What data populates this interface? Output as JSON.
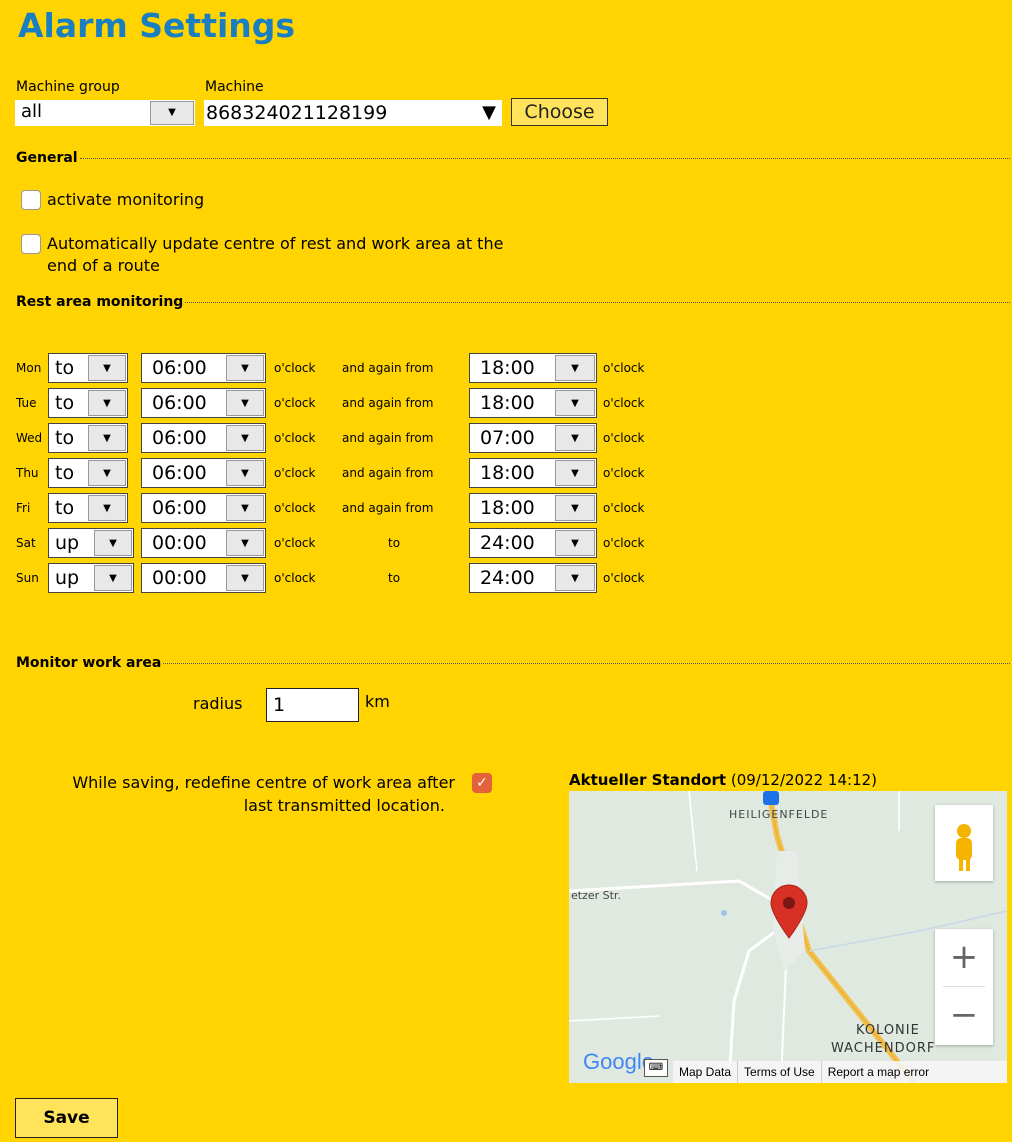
{
  "header": {
    "title": "Alarm Settings"
  },
  "machine": {
    "group_label": "Machine group",
    "group_value": "all",
    "machine_label": "Machine",
    "machine_value": "868324021128199",
    "choose_label": "Choose"
  },
  "general": {
    "title": "General",
    "activate_label": "activate monitoring",
    "activate_checked": false,
    "auto_update_label_1": "Automatically update centre of rest and work area at the",
    "auto_update_label_2": "end of a route",
    "auto_update_checked": false
  },
  "rest": {
    "title": "Rest area monitoring",
    "oclock": "o'clock",
    "days": [
      {
        "day": "Mon",
        "mode": "to",
        "time1": "06:00",
        "middle": "and again from",
        "time2": "18:00"
      },
      {
        "day": "Tue",
        "mode": "to",
        "time1": "06:00",
        "middle": "and again from",
        "time2": "18:00"
      },
      {
        "day": "Wed",
        "mode": "to",
        "time1": "06:00",
        "middle": "and again from",
        "time2": "07:00"
      },
      {
        "day": "Thu",
        "mode": "to",
        "time1": "06:00",
        "middle": "and again from",
        "time2": "18:00"
      },
      {
        "day": "Fri",
        "mode": "to",
        "time1": "06:00",
        "middle": "and again from",
        "time2": "18:00"
      },
      {
        "day": "Sat",
        "mode": "up",
        "time1": "00:00",
        "middle": "to",
        "time2": "24:00"
      },
      {
        "day": "Sun",
        "mode": "up",
        "time1": "00:00",
        "middle": "to",
        "time2": "24:00"
      }
    ]
  },
  "work": {
    "title": "Monitor work area",
    "radius_label": "radius",
    "radius_value": "1",
    "radius_unit": "km",
    "redefine_line1": "While saving, redefine centre of work area after",
    "redefine_line2": "last transmitted location.",
    "redefine_checked": true
  },
  "location": {
    "title": "Aktueller Standort",
    "timestamp": "(09/12/2022 14:12)"
  },
  "map": {
    "place1": "HEILIGENFELDE",
    "place2_1": "KOLONIE",
    "place2_2": "WACHENDORF",
    "street": "etzer Str.",
    "logo": "Google",
    "attrib_data": "Map Data",
    "attrib_terms": "Terms of Use",
    "attrib_report": "Report a map error",
    "colors": {
      "land": "#dfe9df",
      "highway": "#f2c14e",
      "pin": "#d93025"
    }
  },
  "footer": {
    "save_label": "Save"
  },
  "colors": {
    "background": "#ffd400",
    "title": "#1a7fc0",
    "checkbox_checked": "#e2623a"
  }
}
